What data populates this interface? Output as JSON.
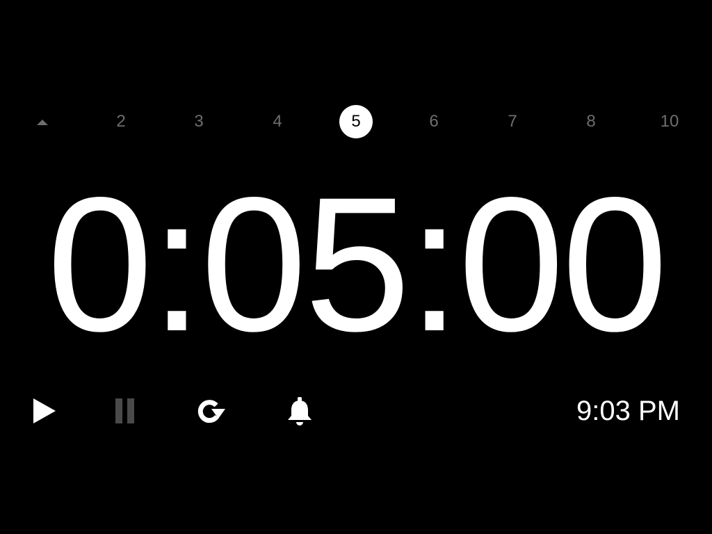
{
  "selector": {
    "up_icon": "triangle-up-icon",
    "options": [
      "2",
      "3",
      "4",
      "5",
      "6",
      "7",
      "8",
      "10"
    ],
    "selected": "5"
  },
  "timer": {
    "display": "0:05:00"
  },
  "controls": {
    "play_icon": "play-icon",
    "pause_icon": "pause-icon",
    "reset_icon": "reset-icon",
    "alarm_icon": "bell-icon"
  },
  "clock": {
    "time": "9:03 PM"
  },
  "colors": {
    "background": "#000000",
    "foreground": "#ffffff",
    "dimmed": "#6e6e6e",
    "disabled": "#4a4a4a"
  }
}
